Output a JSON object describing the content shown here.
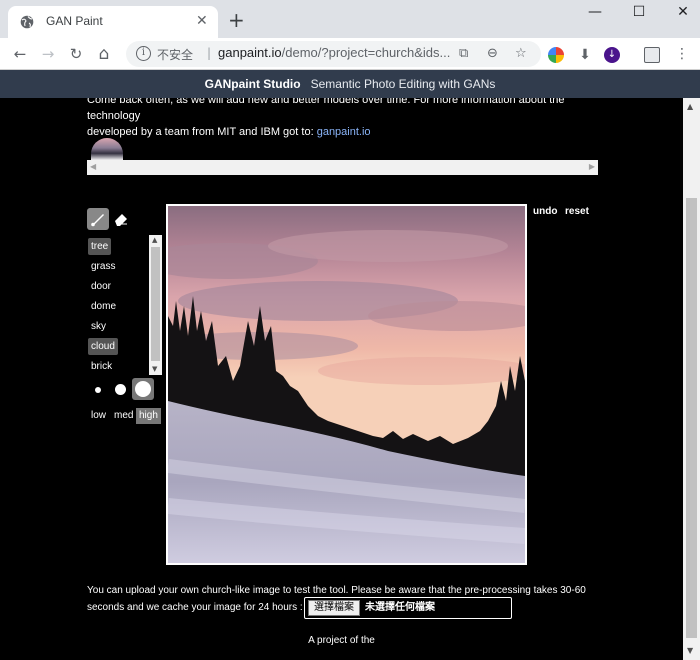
{
  "browser": {
    "tab_title": "GAN Paint",
    "new_tab": "+",
    "window_controls": {
      "minimize": "—",
      "maximize": "☐",
      "close": "✕"
    },
    "nav": {
      "back": "←",
      "forward": "→",
      "reload": "↻",
      "home": "⌂"
    },
    "security_label": "不安全",
    "separator": "|",
    "url_host": "ganpaint.io",
    "url_path": "/demo/?project=church&ids...",
    "omnibox_icons": [
      "translate-icon",
      "zoom-icon",
      "star-icon"
    ]
  },
  "site": {
    "brand": "GANpaint Studio",
    "tagline": "Semantic Photo Editing with GANs"
  },
  "intro": {
    "line1": "Come back often, as we will add new and better models over time. For more information about the technology",
    "line2_prefix": "developed by a team from MIT and IBM got to:",
    "line2_link": "ganpaint.io"
  },
  "tools": {
    "labels": [
      "tree",
      "grass",
      "door",
      "dome",
      "sky",
      "cloud",
      "brick"
    ],
    "selected_labels": [
      "tree",
      "cloud"
    ],
    "brush_sizes": [
      "small",
      "medium",
      "large"
    ],
    "selected_brush_size": "large",
    "strengths": [
      "low",
      "med",
      "high"
    ],
    "selected_strength": "high"
  },
  "actions": {
    "undo": "undo",
    "reset": "reset"
  },
  "upload": {
    "line1": "You can upload your own church-like image to test the tool. Please be aware that the pre-processing takes 30-60",
    "line2": "seconds and we cache your image for 24 hours :",
    "button": "選擇檔案",
    "no_file": "未選擇任何檔案"
  },
  "footer": {
    "text": "A project of the"
  }
}
